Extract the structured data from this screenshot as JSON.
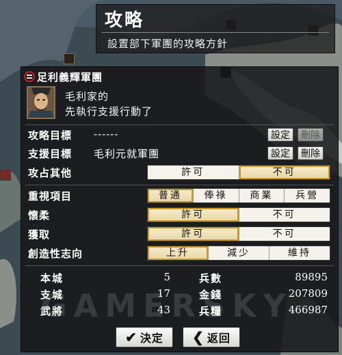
{
  "screen": {
    "title": "攻略",
    "subtitle": "設置部下軍團的攻略方針"
  },
  "dialog": {
    "title": "足利義輝軍團",
    "message_line1": "毛利家的",
    "message_line2": "先執行支援行動了",
    "rows": {
      "target": {
        "label": "攻略目標",
        "value": "------",
        "set_label": "設定",
        "delete_label": "刪除"
      },
      "support": {
        "label": "支援目標",
        "value": "毛利元就軍團",
        "set_label": "設定",
        "delete_label": "刪除"
      },
      "attack_other": {
        "label": "攻占其他",
        "options": [
          "許可",
          "不可"
        ],
        "selected": 1
      },
      "priority": {
        "label": "重視項目",
        "options": [
          "普通",
          "俸祿",
          "商業",
          "兵營"
        ],
        "selected": 0
      },
      "conciliate": {
        "label": "懷柔",
        "options": [
          "許可",
          "不可"
        ],
        "selected": 0
      },
      "capture": {
        "label": "獲取",
        "options": [
          "許可",
          "不可"
        ],
        "selected": 0
      },
      "creativity": {
        "label": "創造性志向",
        "options": [
          "上升",
          "減少",
          "維持"
        ],
        "selected": 0
      }
    },
    "stats": {
      "castle_label": "本城",
      "castle_value": "5",
      "branch_label": "支城",
      "branch_value": "17",
      "generals_label": "武將",
      "generals_value": "43",
      "troops_label": "兵數",
      "troops_value": "89895",
      "gold_label": "金錢",
      "gold_value": "207809",
      "rice_label": "兵糧",
      "rice_value": "466987"
    },
    "confirm_label": "決定",
    "back_label": "返回"
  },
  "watermark": "GAMERSKY"
}
